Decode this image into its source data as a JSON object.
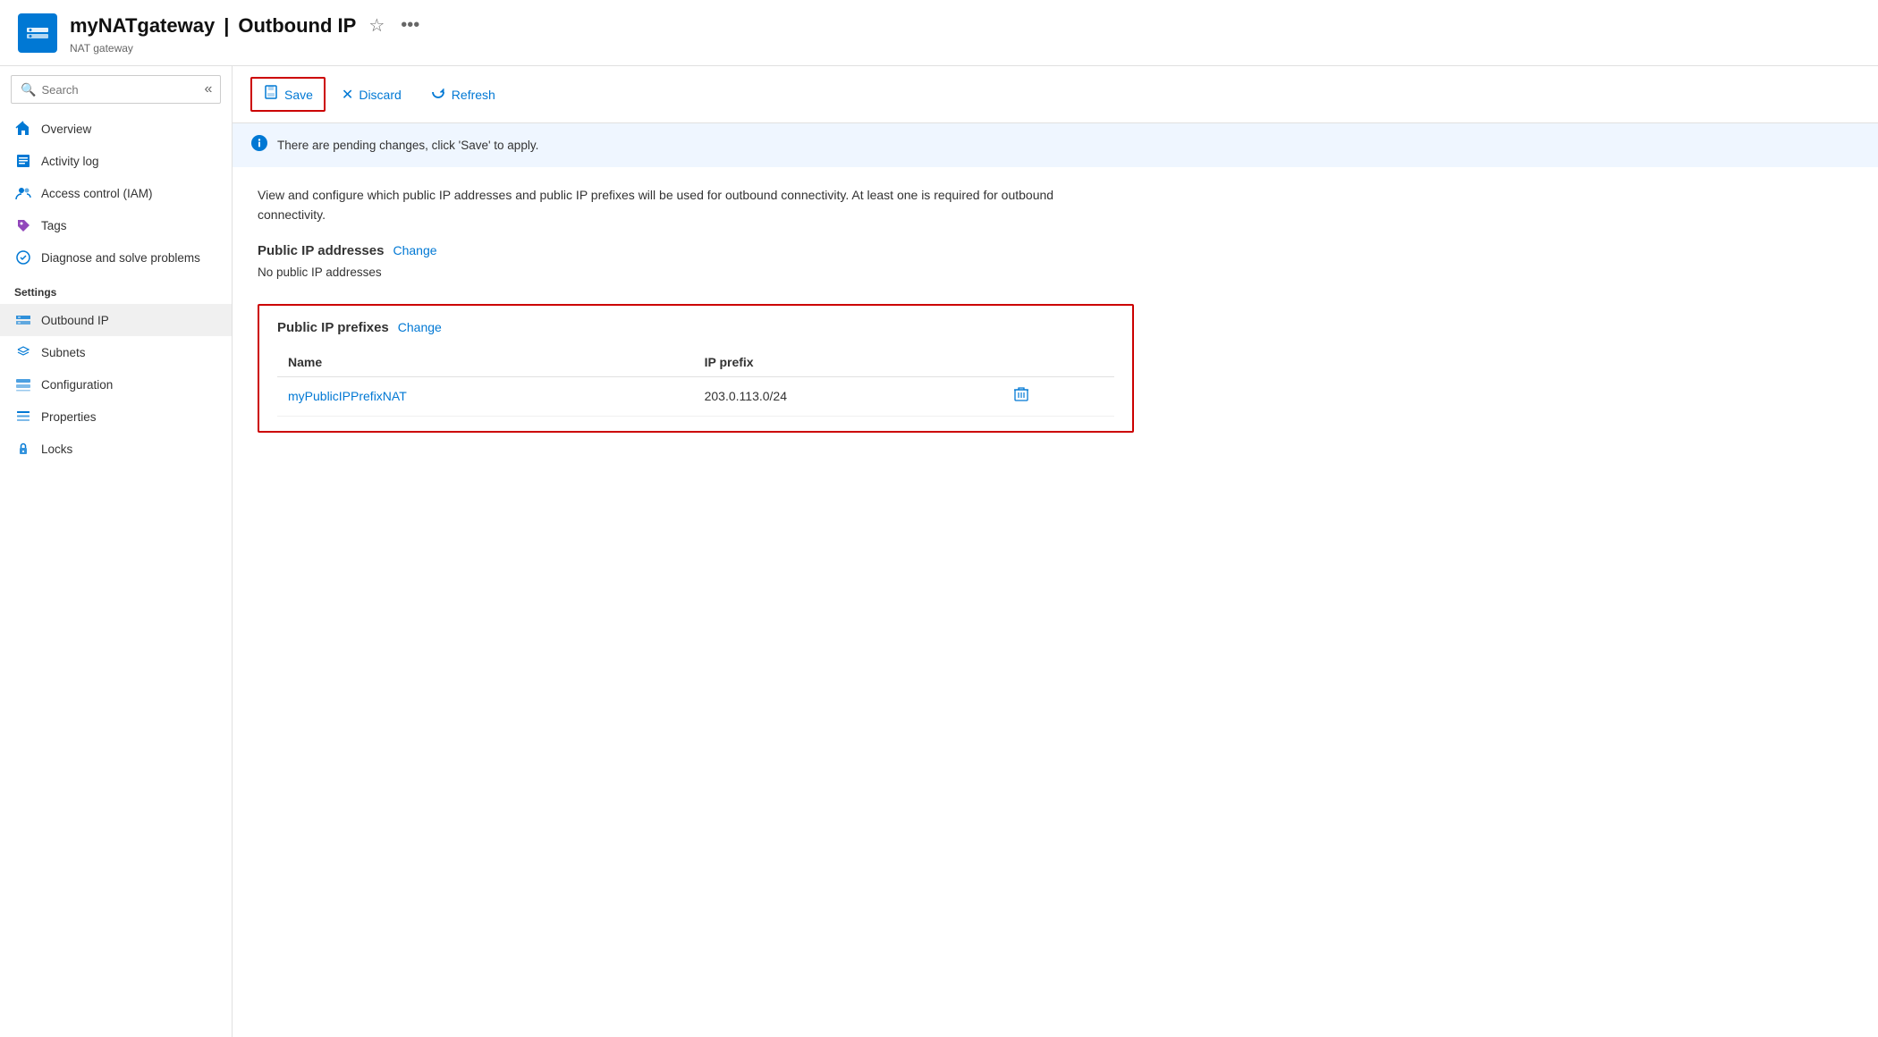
{
  "header": {
    "title": "myNATgateway",
    "separator": "|",
    "page": "Outbound IP",
    "subtitle": "NAT gateway",
    "favorite_label": "★",
    "more_label": "..."
  },
  "toolbar": {
    "save_label": "Save",
    "discard_label": "Discard",
    "refresh_label": "Refresh"
  },
  "info_banner": {
    "message": "There are pending changes, click 'Save' to apply."
  },
  "search": {
    "placeholder": "Search"
  },
  "sidebar": {
    "nav_items": [
      {
        "id": "overview",
        "label": "Overview",
        "icon": "diamond"
      },
      {
        "id": "activity-log",
        "label": "Activity log",
        "icon": "list"
      },
      {
        "id": "iam",
        "label": "Access control (IAM)",
        "icon": "people"
      },
      {
        "id": "tags",
        "label": "Tags",
        "icon": "tag"
      },
      {
        "id": "diagnose",
        "label": "Diagnose and solve problems",
        "icon": "wrench"
      }
    ],
    "settings_label": "Settings",
    "settings_items": [
      {
        "id": "outbound-ip",
        "label": "Outbound IP",
        "icon": "grid",
        "active": true
      },
      {
        "id": "subnets",
        "label": "Subnets",
        "icon": "diamond-code"
      },
      {
        "id": "configuration",
        "label": "Configuration",
        "icon": "db"
      },
      {
        "id": "properties",
        "label": "Properties",
        "icon": "bars"
      },
      {
        "id": "locks",
        "label": "Locks",
        "icon": "lock"
      }
    ]
  },
  "content": {
    "description": "View and configure which public IP addresses and public IP prefixes will be used for outbound connectivity. At least one is required for outbound connectivity.",
    "public_ip_section": {
      "heading": "Public IP addresses",
      "change_label": "Change",
      "no_items_text": "No public IP addresses"
    },
    "public_ip_prefixes_section": {
      "heading": "Public IP prefixes",
      "change_label": "Change",
      "table": {
        "columns": [
          {
            "id": "name",
            "label": "Name"
          },
          {
            "id": "ip_prefix",
            "label": "IP prefix"
          }
        ],
        "rows": [
          {
            "name": "myPublicIPPrefixNAT",
            "ip_prefix": "203.0.113.0/24"
          }
        ]
      }
    }
  }
}
